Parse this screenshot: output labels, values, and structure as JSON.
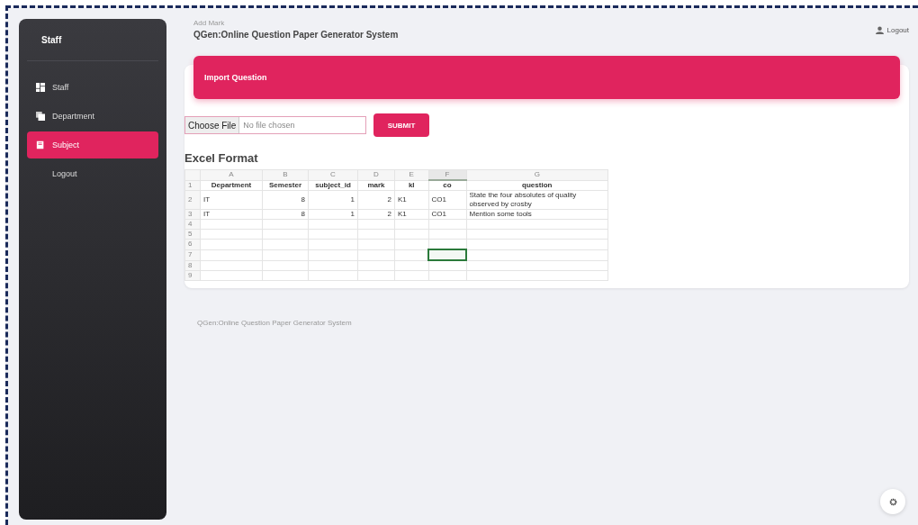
{
  "sidebar": {
    "title": "Staff",
    "items": [
      {
        "label": "Staff",
        "selected": false
      },
      {
        "label": "Department",
        "selected": false
      },
      {
        "label": "Subject",
        "selected": true
      },
      {
        "label": "Logout",
        "selected": false
      }
    ]
  },
  "header": {
    "breadcrumb": "Add Mark",
    "title": "QGen:Online Question Paper Generator System",
    "logout": "Logout"
  },
  "card": {
    "title": "Import Question",
    "file_button": "Choose File",
    "file_status": "No file chosen",
    "submit": "SUBMIT",
    "section_title": "Excel Format"
  },
  "sheet": {
    "columns": [
      {
        "label": "A",
        "selected": false
      },
      {
        "label": "B",
        "selected": false
      },
      {
        "label": "C",
        "selected": false
      },
      {
        "label": "D",
        "selected": false
      },
      {
        "label": "E",
        "selected": false
      },
      {
        "label": "F",
        "selected": true
      },
      {
        "label": "G",
        "selected": false
      }
    ],
    "rows": [
      {
        "num": "1",
        "kind": "header",
        "cells": [
          {
            "text": "Department",
            "selected": false
          },
          {
            "text": "Semester",
            "selected": false
          },
          {
            "text": "subject_id",
            "selected": false
          },
          {
            "text": "mark",
            "selected": false
          },
          {
            "text": "kl",
            "selected": false
          },
          {
            "text": "co",
            "selected": false
          },
          {
            "text": "question",
            "selected": false
          }
        ]
      },
      {
        "num": "2",
        "kind": "data",
        "cells": [
          {
            "text": "IT",
            "selected": false
          },
          {
            "text": "8",
            "selected": false
          },
          {
            "text": "1",
            "selected": false
          },
          {
            "text": "2",
            "selected": false
          },
          {
            "text": "K1",
            "selected": false
          },
          {
            "text": "CO1",
            "selected": false
          },
          {
            "text": "State the four absolutes of quality observed by crosby",
            "selected": false
          }
        ]
      },
      {
        "num": "3",
        "kind": "data",
        "cells": [
          {
            "text": "IT",
            "selected": false
          },
          {
            "text": "8",
            "selected": false
          },
          {
            "text": "1",
            "selected": false
          },
          {
            "text": "2",
            "selected": false
          },
          {
            "text": "K1",
            "selected": false
          },
          {
            "text": "CO1",
            "selected": false
          },
          {
            "text": "Mention some tools",
            "selected": false
          }
        ]
      },
      {
        "num": "4",
        "kind": "data",
        "cells": [
          {
            "selected": false
          },
          {
            "selected": false
          },
          {
            "selected": false
          },
          {
            "selected": false
          },
          {
            "selected": false
          },
          {
            "selected": false
          },
          {
            "selected": false
          }
        ]
      },
      {
        "num": "5",
        "kind": "data",
        "cells": [
          {
            "selected": false
          },
          {
            "selected": false
          },
          {
            "selected": false
          },
          {
            "selected": false
          },
          {
            "selected": false
          },
          {
            "selected": false
          },
          {
            "selected": false
          }
        ]
      },
      {
        "num": "6",
        "kind": "data",
        "cells": [
          {
            "selected": false
          },
          {
            "selected": false
          },
          {
            "selected": false
          },
          {
            "selected": false
          },
          {
            "selected": false
          },
          {
            "selected": false
          },
          {
            "selected": false
          }
        ]
      },
      {
        "num": "7",
        "kind": "data",
        "cells": [
          {
            "selected": false
          },
          {
            "selected": false
          },
          {
            "selected": false
          },
          {
            "selected": false
          },
          {
            "selected": false
          },
          {
            "selected": true
          },
          {
            "selected": false
          }
        ]
      },
      {
        "num": "8",
        "kind": "data",
        "cells": [
          {
            "selected": false
          },
          {
            "selected": false
          },
          {
            "selected": false
          },
          {
            "selected": false
          },
          {
            "selected": false
          },
          {
            "selected": false
          },
          {
            "selected": false
          }
        ]
      },
      {
        "num": "9",
        "kind": "data",
        "cells": [
          {
            "selected": false
          },
          {
            "selected": false
          },
          {
            "selected": false
          },
          {
            "selected": false
          },
          {
            "selected": false
          },
          {
            "selected": false
          },
          {
            "selected": false
          }
        ]
      }
    ]
  },
  "footer": "QGen:Online Question Paper Generator System"
}
